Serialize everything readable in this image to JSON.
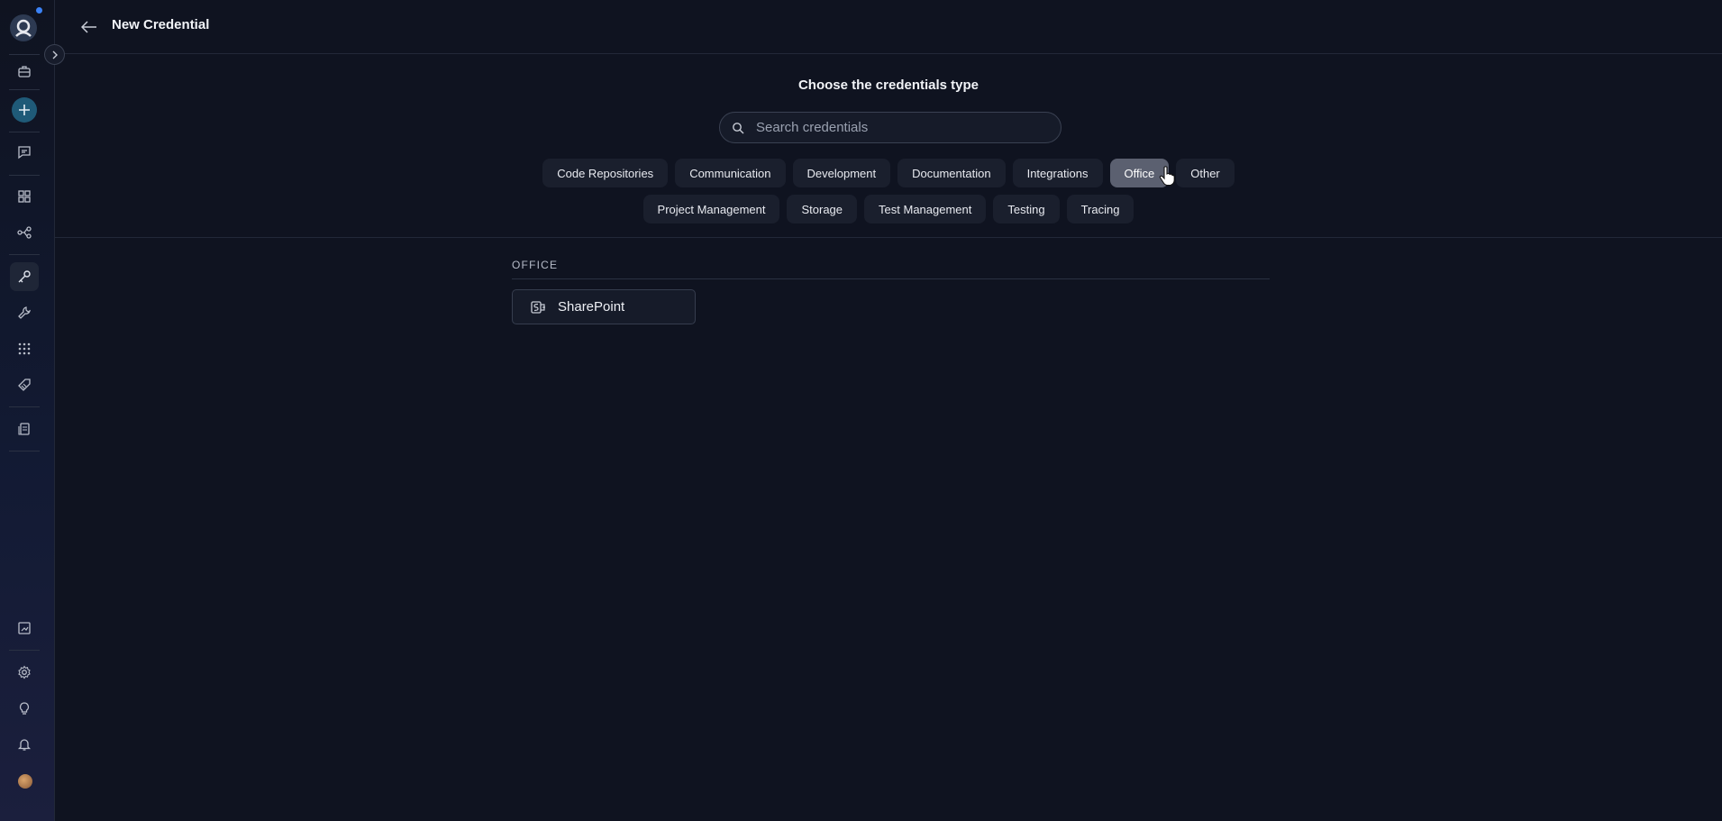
{
  "sidebar": {
    "top_icons": [
      "home-icon",
      "briefcase-icon",
      "plus-icon",
      "chat-icon",
      "grid-icon",
      "flow-icon",
      "key-icon",
      "wrench-icon",
      "apps-icon",
      "tag-icon",
      "document-icon"
    ],
    "bottom_icons": [
      "report-icon",
      "settings-icon",
      "lightbulb-icon",
      "bell-icon",
      "avatar"
    ]
  },
  "header": {
    "title": "New Credential"
  },
  "main": {
    "heading": "Choose the credentials type",
    "search": {
      "placeholder": "Search credentials",
      "value": ""
    },
    "categories_row1": [
      "Code Repositories",
      "Communication",
      "Development",
      "Documentation",
      "Integrations",
      "Office",
      "Other"
    ],
    "categories_row2": [
      "Project Management",
      "Storage",
      "Test Management",
      "Testing",
      "Tracing"
    ],
    "selected_category": "Office",
    "section": {
      "label": "OFFICE",
      "items": [
        {
          "label": "SharePoint",
          "icon": "sharepoint-icon"
        }
      ]
    }
  },
  "colors": {
    "background": "#0f1320",
    "chip": "#1a1f2d",
    "chip_selected": "#5b6070",
    "accent": "#1f5a78",
    "notification_dot": "#3b82f6"
  }
}
